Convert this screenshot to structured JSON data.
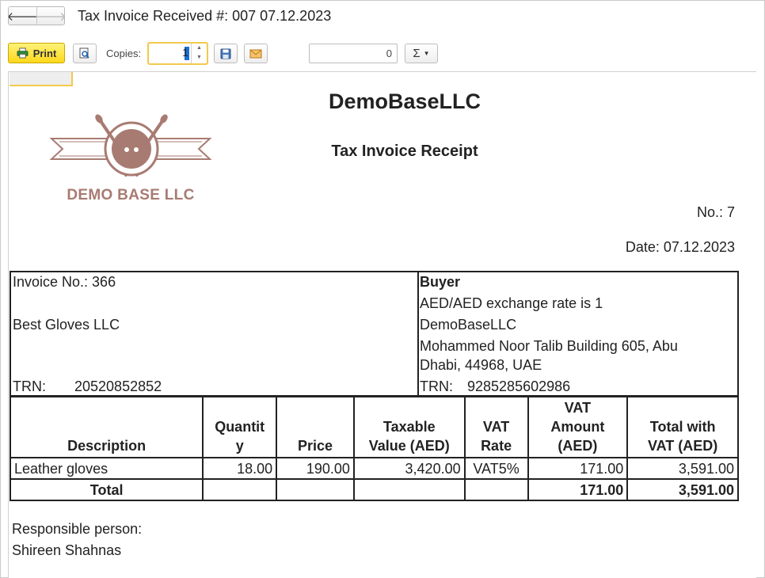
{
  "window": {
    "title": "Tax Invoice Received #: 007 07.12.2023"
  },
  "toolbar": {
    "print_label": "Print",
    "copies_label": "Copies:",
    "copies_value": "1",
    "sum_value": "0",
    "sigma_label": "Σ"
  },
  "document": {
    "logo_text": "DEMO BASE LLC",
    "company": "DemoBaseLLC",
    "title": "Tax Invoice Receipt",
    "number": "No.: 7",
    "date": "Date: 07.12.2023"
  },
  "supplier": {
    "invoice_no": "Invoice No.: 366",
    "name": "Best Gloves LLC",
    "trn_label": "TRN:",
    "trn_value": "20520852852"
  },
  "buyer": {
    "heading": "Buyer",
    "exchange_rate": "AED/AED exchange rate is 1",
    "name": "DemoBaseLLC",
    "address_line1": "Mohammed Noor Talib Building 605, Abu",
    "address_line2": "Dhabi, 44968, UAE",
    "trn_label": "TRN:",
    "trn_value": "9285285602986"
  },
  "table": {
    "headers": {
      "description": "Description",
      "quantity_1": "Quantit",
      "quantity_2": "y",
      "price": "Price",
      "taxable_1": "Taxable",
      "taxable_2": "Value (AED)",
      "vat_rate_1": "VAT",
      "vat_rate_2": "Rate",
      "vat_amount_1": "VAT",
      "vat_amount_2": "Amount",
      "vat_amount_3": "(AED)",
      "total_1": "Total with",
      "total_2": "VAT (AED)"
    },
    "rows": [
      {
        "description": "Leather gloves",
        "quantity": "18.00",
        "price": "190.00",
        "taxable": "3,420.00",
        "vat_rate": "VAT5%",
        "vat_amount": "171.00",
        "total": "3,591.00"
      }
    ],
    "totals": {
      "label": "Total",
      "vat_amount": "171.00",
      "total": "3,591.00"
    }
  },
  "footer": {
    "responsible_label": "Responsible person:",
    "responsible_name": "Shireen Shahnas"
  },
  "colors": {
    "logo": "#a87b72",
    "print_button": "#ffd81b",
    "highlight": "#f2c94c"
  },
  "icons": {
    "back": "arrow-left-icon",
    "forward": "arrow-right-icon",
    "print": "printer-icon",
    "preview": "magnifier-icon",
    "save": "floppy-disk-icon",
    "email": "envelope-icon",
    "sum": "sigma-icon"
  }
}
